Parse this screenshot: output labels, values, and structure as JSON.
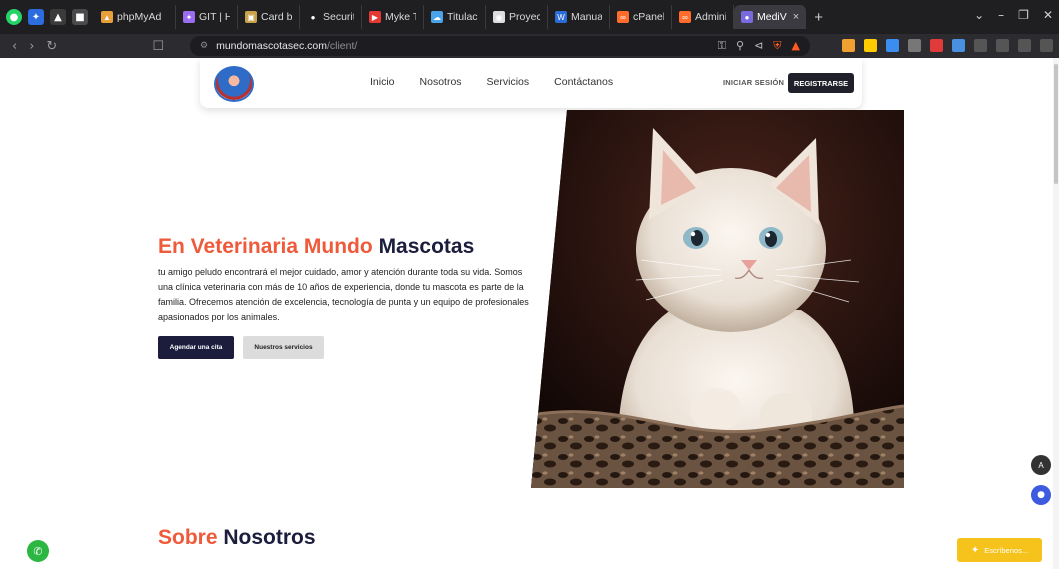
{
  "browser": {
    "tabs": [
      {
        "label": "phpMyAd",
        "color": "#e8a03b",
        "glyph": "▲"
      },
      {
        "label": "GIT | Hosti",
        "color": "#9b6cf0",
        "glyph": "✦"
      },
      {
        "label": "Card by C",
        "color": "#c8a24a",
        "glyph": "▣"
      },
      {
        "label": "Security - A",
        "color": "#ffffff",
        "glyph": "●"
      },
      {
        "label": "Myke Tow",
        "color": "#e53935",
        "glyph": "▶"
      },
      {
        "label": "Titulacion",
        "color": "#4aa3e8",
        "glyph": "☁"
      },
      {
        "label": "Proyecto C",
        "color": "#dddddd",
        "glyph": "◉"
      },
      {
        "label": "Manual Te",
        "color": "#2b6cd8",
        "glyph": "W"
      },
      {
        "label": "cPanel - T",
        "color": "#ff6c2c",
        "glyph": "∞"
      },
      {
        "label": "Administr",
        "color": "#ff6c2c",
        "glyph": "∞"
      }
    ],
    "active_tab": {
      "label": "MediV",
      "close": "×"
    },
    "new_tab": "+",
    "url_host": "mundomascotasec.com",
    "url_path": "/client/"
  },
  "nav": {
    "links": [
      "Inicio",
      "Nosotros",
      "Servicios",
      "Contáctanos"
    ],
    "login": "INICIAR SESIÓN",
    "register": "REGISTRARSE"
  },
  "hero": {
    "title_orange": "En Veterinaria Mundo",
    "title_dark": "Mascotas",
    "text": "tu amigo peludo encontrará el mejor cuidado, amor y atención durante toda su vida. Somos una clínica veterinaria con más de 10 años de experiencia, donde tu mascota es parte de la familia. Ofrecemos atención de excelencia, tecnología de punta y un equipo de profesionales apasionados por los animales.",
    "primary_button": "Agendar una cita",
    "secondary_button": "Nuestros servicios"
  },
  "about": {
    "title_orange": "Sobre",
    "title_dark": "Nosotros"
  },
  "widgets": {
    "chat_label": "Escríbenos..."
  },
  "colors": {
    "accent_orange": "#ee5a3a",
    "navy": "#1c1d3d",
    "whatsapp": "#2bb741",
    "chat_yellow": "#f6c21c"
  }
}
